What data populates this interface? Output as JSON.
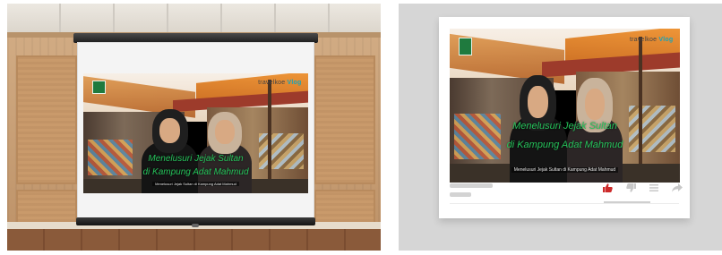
{
  "video": {
    "title_line1": "Menelusuri Jejak Sultan",
    "title_line2": "di Kampung Adat Mahmud",
    "caption": "Menelusuri Jejak Sultan di Kampung Adat Mahmud",
    "watermark_left": "travelkoe",
    "watermark_right": "Vlog"
  },
  "player": {
    "icons": [
      "thumbs-up-icon",
      "thumbs-down-icon",
      "menu-icon",
      "share-icon"
    ],
    "accent_color": "#cc2a2a"
  }
}
